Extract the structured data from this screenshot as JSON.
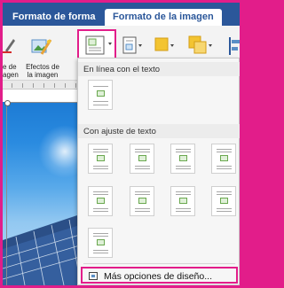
{
  "tabs": [
    {
      "label": "Formato de forma",
      "active": false
    },
    {
      "label": "Formato de la imagen",
      "active": true
    }
  ],
  "ribbon": {
    "left_label_line1": "e de",
    "left_label_line2": "agen",
    "effects_label_line1": "Efectos de",
    "effects_label_line2": "la imagen",
    "icons": [
      "pen-icon",
      "picture-effects-icon",
      "wrap-text-icon",
      "position-icon",
      "shape-fill-icon",
      "arrange-icon",
      "align-icon"
    ]
  },
  "dropdown": {
    "section_inline": "En línea con el texto",
    "section_wrap": "Con ajuste de texto",
    "more_options": "Más opciones de diseño..."
  },
  "colors": {
    "ribbon_blue": "#2b579a",
    "highlight": "#e21d8a"
  }
}
